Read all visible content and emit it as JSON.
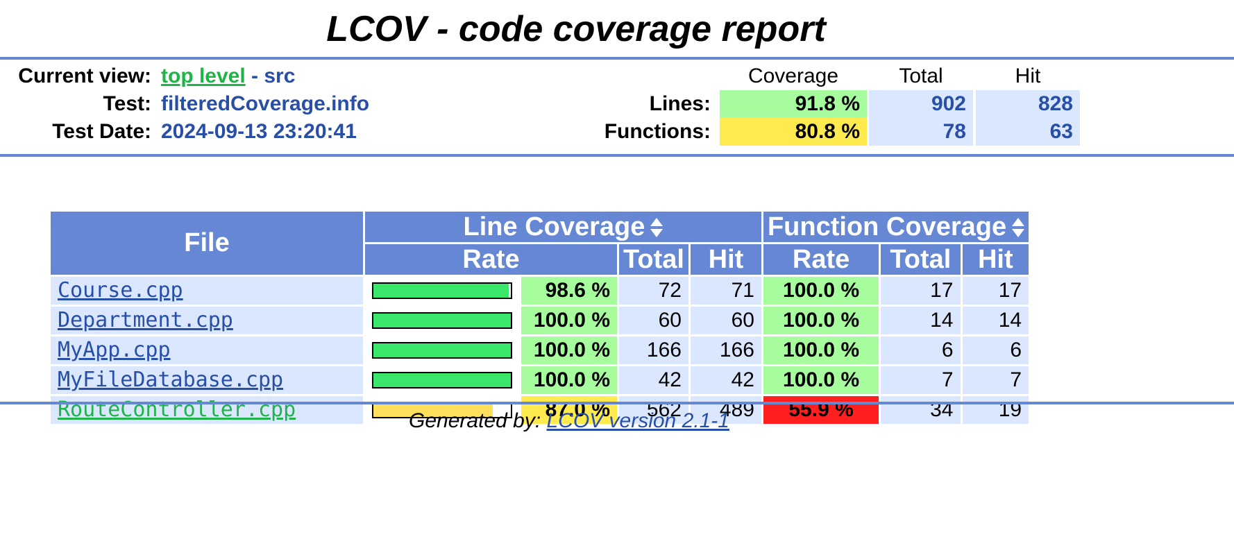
{
  "title": "LCOV - code coverage report",
  "header": {
    "current_view_label": "Current view:",
    "current_view_link": "top level",
    "current_view_sep": " - ",
    "current_view_dir": "src",
    "test_label": "Test:",
    "test_value": "filteredCoverage.info",
    "test_date_label": "Test Date:",
    "test_date_value": "2024-09-13 23:20:41"
  },
  "summary": {
    "col_coverage": "Coverage",
    "col_total": "Total",
    "col_hit": "Hit",
    "lines": {
      "label": "Lines:",
      "coverage": "91.8 %",
      "total": "902",
      "hit": "828",
      "level": "hi"
    },
    "functions": {
      "label": "Functions:",
      "coverage": "80.8 %",
      "total": "78",
      "hit": "63",
      "level": "med"
    }
  },
  "table": {
    "file_header": "File",
    "line_coverage_header": "Line Coverage",
    "function_coverage_header": "Function Coverage",
    "rate_header": "Rate",
    "total_header": "Total",
    "hit_header": "Hit",
    "rows": [
      {
        "file": "Course.cpp",
        "line_rate": "98.6 %",
        "line_fraction": 0.986,
        "line_total": "72",
        "line_hit": "71",
        "func_rate": "100.0 %",
        "func_total": "17",
        "func_hit": "17",
        "line_level": "hi",
        "func_level": "hi",
        "link_color": "blue"
      },
      {
        "file": "Department.cpp",
        "line_rate": "100.0 %",
        "line_fraction": 1.0,
        "line_total": "60",
        "line_hit": "60",
        "func_rate": "100.0 %",
        "func_total": "14",
        "func_hit": "14",
        "line_level": "hi",
        "func_level": "hi",
        "link_color": "blue"
      },
      {
        "file": "MyApp.cpp",
        "line_rate": "100.0 %",
        "line_fraction": 1.0,
        "line_total": "166",
        "line_hit": "166",
        "func_rate": "100.0 %",
        "func_total": "6",
        "func_hit": "6",
        "line_level": "hi",
        "func_level": "hi",
        "link_color": "blue"
      },
      {
        "file": "MyFileDatabase.cpp",
        "line_rate": "100.0 %",
        "line_fraction": 1.0,
        "line_total": "42",
        "line_hit": "42",
        "func_rate": "100.0 %",
        "func_total": "7",
        "func_hit": "7",
        "line_level": "hi",
        "func_level": "hi",
        "link_color": "blue"
      },
      {
        "file": "RouteController.cpp",
        "line_rate": "87.0 %",
        "line_fraction": 0.87,
        "line_total": "562",
        "line_hit": "489",
        "func_rate": "55.9 %",
        "func_total": "34",
        "func_hit": "19",
        "line_level": "med",
        "func_level": "lo",
        "link_color": "green"
      }
    ]
  },
  "footer": {
    "prefix": "Generated by: ",
    "link": "LCOV version 2.1-1"
  },
  "colors": {
    "rule": "#6688d4",
    "hi": "#a7fc9d",
    "med": "#ffea50",
    "lo": "#ff1f1f",
    "bar_hi": "#39e86b",
    "bar_med": "#ffe05c",
    "link_blue": "#284fa8",
    "link_green": "#1fb447",
    "cell_bg": "#dae7fe"
  },
  "icons": {
    "sort": "sort-up-down-icon"
  }
}
